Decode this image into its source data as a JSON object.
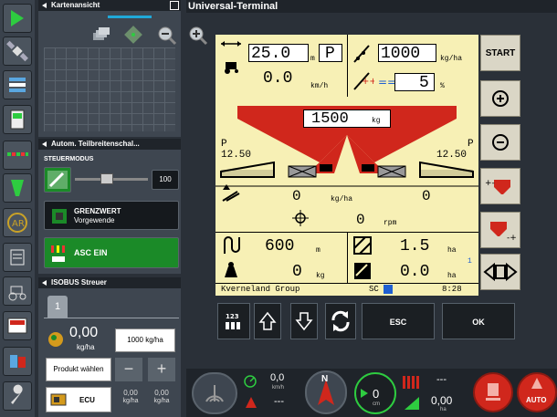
{
  "top_panel": {
    "title": "Kartenansicht"
  },
  "section_panel": {
    "title": "Autom. Teilbreitenschal...",
    "steuermodus_label": "STEUERMODUS",
    "overlap_value": "100",
    "grenzwert_label": "GRENZWERT",
    "grenzwert_sub": "Vorgewende",
    "asc_label": "ASC EIN"
  },
  "isobus_panel": {
    "title": "ISOBUS Streuer",
    "tab_number": "1",
    "rate_value": "0,00",
    "rate_unit": "kg/ha",
    "target_rate": "1000 kg/ha",
    "product_select": "Produkt wählen",
    "minus": "−",
    "plus": "+",
    "ecu_label": "ECU",
    "left_val": "0,00",
    "left_unit": "kg/ha",
    "right_val": "0,00",
    "right_unit": "kg/ha"
  },
  "ut": {
    "title": "Universal-Terminal",
    "speed_target": "25.0",
    "speed_unit": "m",
    "speed_mode": "P",
    "speed_actual": "0.0",
    "speed_actual_unit": "km/h",
    "rate_target": "1000",
    "rate_target_unit": "kg/ha",
    "rate_step": "5",
    "rate_step_unit": "%",
    "hopper": "1500",
    "hopper_unit": "kg",
    "left_p": "P",
    "left_width": "12.50",
    "right_p": "P",
    "right_width": "12.50",
    "left_rate": "0",
    "rate_unit": "kg/ha",
    "right_rate": "0",
    "rpm": "0",
    "rpm_unit": "rpm",
    "distance": "600",
    "distance_unit": "m",
    "weight": "0",
    "weight_unit": "kg",
    "area1": "1.5",
    "area1_unit": "ha",
    "area2": "0.0",
    "area2_unit": "ha",
    "counter_index": "1",
    "brand": "Kverneland Group",
    "sc_label": "SC",
    "time": "8:28",
    "softkeys": {
      "start": "START"
    },
    "bottom_keys": {
      "esc": "ESC",
      "ok": "OK"
    }
  },
  "status_bar": {
    "speed_value": "0,0",
    "speed_unit": "km/h",
    "speed_dash": "---",
    "compass_label": "N",
    "offset_value": "0",
    "offset_unit": "cm",
    "section_dash": "---",
    "area_value": "0,00",
    "area_unit": "ha",
    "auto_label": "AUTO"
  },
  "colors": {
    "ut_background": "#f7f0b5",
    "hopper_red": "#d0271c",
    "asc_green": "#1b8a28",
    "accent_cyan": "#20a8d8"
  }
}
